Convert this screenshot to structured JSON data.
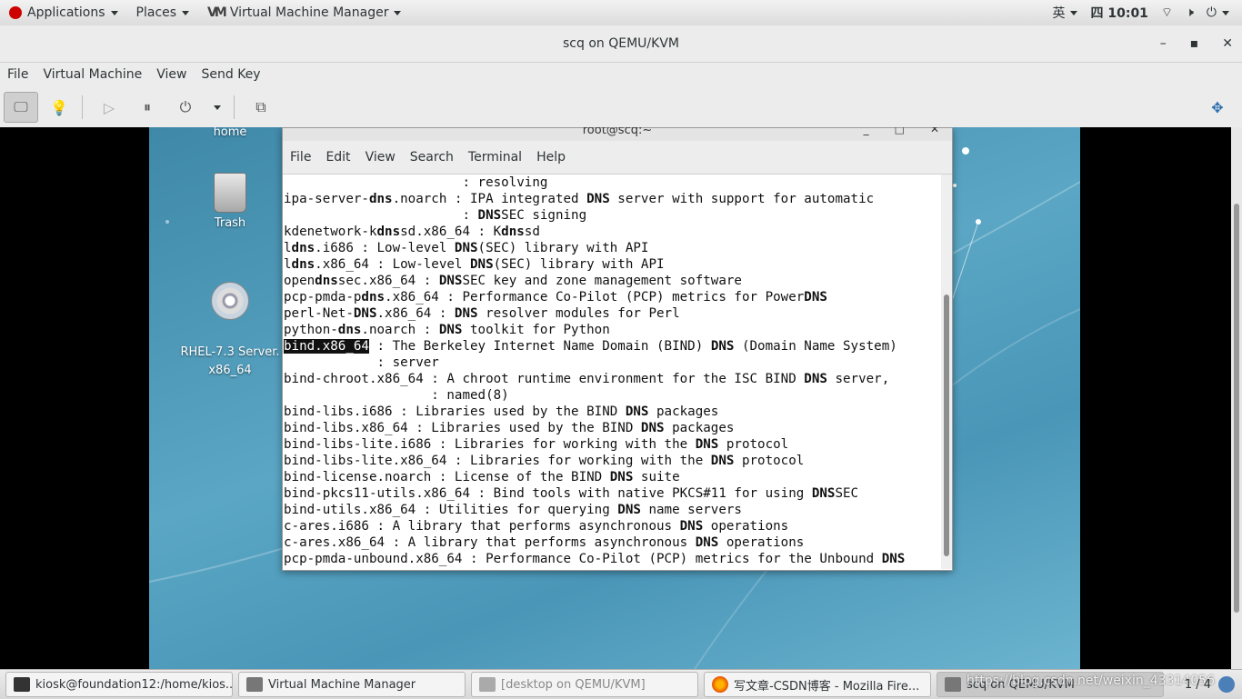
{
  "topbar": {
    "applications": "Applications",
    "places": "Places",
    "vmm": "Virtual Machine Manager",
    "ime": "英",
    "datetime": "四 10:01"
  },
  "window": {
    "title": "scq on QEMU/KVM",
    "menu": [
      "File",
      "Virtual Machine",
      "View",
      "Send Key"
    ]
  },
  "desktop": {
    "icons": [
      {
        "label": "home"
      },
      {
        "label": "Trash"
      },
      {
        "label": "RHEL-7.3 Server.\nx86_64"
      }
    ]
  },
  "terminal": {
    "title": "root@scq:~",
    "menu": [
      "File",
      "Edit",
      "View",
      "Search",
      "Terminal",
      "Help"
    ],
    "lines": [
      "                       : resolving",
      "ipa-server-dns.noarch : IPA integrated DNS server with support for automatic",
      "                       : DNSSEC signing",
      "kdenetwork-kdnssd.x86_64 : Kdnssd",
      "ldns.i686 : Low-level DNS(SEC) library with API",
      "ldns.x86_64 : Low-level DNS(SEC) library with API",
      "opendnssec.x86_64 : DNSSEC key and zone management software",
      "pcp-pmda-pdns.x86_64 : Performance Co-Pilot (PCP) metrics for PowerDNS",
      "perl-Net-DNS.x86_64 : DNS resolver modules for Perl",
      "python-dns.noarch : DNS toolkit for Python",
      "bind.x86_64 : The Berkeley Internet Name Domain (BIND) DNS (Domain Name System)",
      "            : server",
      "bind-chroot.x86_64 : A chroot runtime environment for the ISC BIND DNS server,",
      "                   : named(8)",
      "bind-libs.i686 : Libraries used by the BIND DNS packages",
      "bind-libs.x86_64 : Libraries used by the BIND DNS packages",
      "bind-libs-lite.i686 : Libraries for working with the DNS protocol",
      "bind-libs-lite.x86_64 : Libraries for working with the DNS protocol",
      "bind-license.noarch : License of the BIND DNS suite",
      "bind-pkcs11-utils.x86_64 : Bind tools with native PKCS#11 for using DNSSEC",
      "bind-utils.x86_64 : Utilities for querying DNS name servers",
      "c-ares.i686 : A library that performs asynchronous DNS operations",
      "c-ares.x86_64 : A library that performs asynchronous DNS operations",
      "pcp-pmda-unbound.x86_64 : Performance Co-Pilot (PCP) metrics for the Unbound DNS"
    ],
    "selected_text": "bind.x86_64",
    "highlight_terms": [
      "dns",
      "DNS",
      "Kdnssd",
      "ldns"
    ]
  },
  "taskbar": {
    "tasks": [
      {
        "label": "kiosk@foundation12:/home/kios...",
        "icon": "terminal-icon"
      },
      {
        "label": "Virtual Machine Manager",
        "icon": "vmm-icon"
      },
      {
        "label": "[desktop on QEMU/KVM]",
        "icon": "vmm-icon"
      },
      {
        "label": "写文章-CSDN博客 - Mozilla Fire...",
        "icon": "firefox-icon"
      },
      {
        "label": "scq on QEMU/KVM",
        "icon": "vmm-icon"
      }
    ],
    "pager": "1 / 4",
    "watermark": "https://blog.csdn.net/weixin_43314056"
  }
}
